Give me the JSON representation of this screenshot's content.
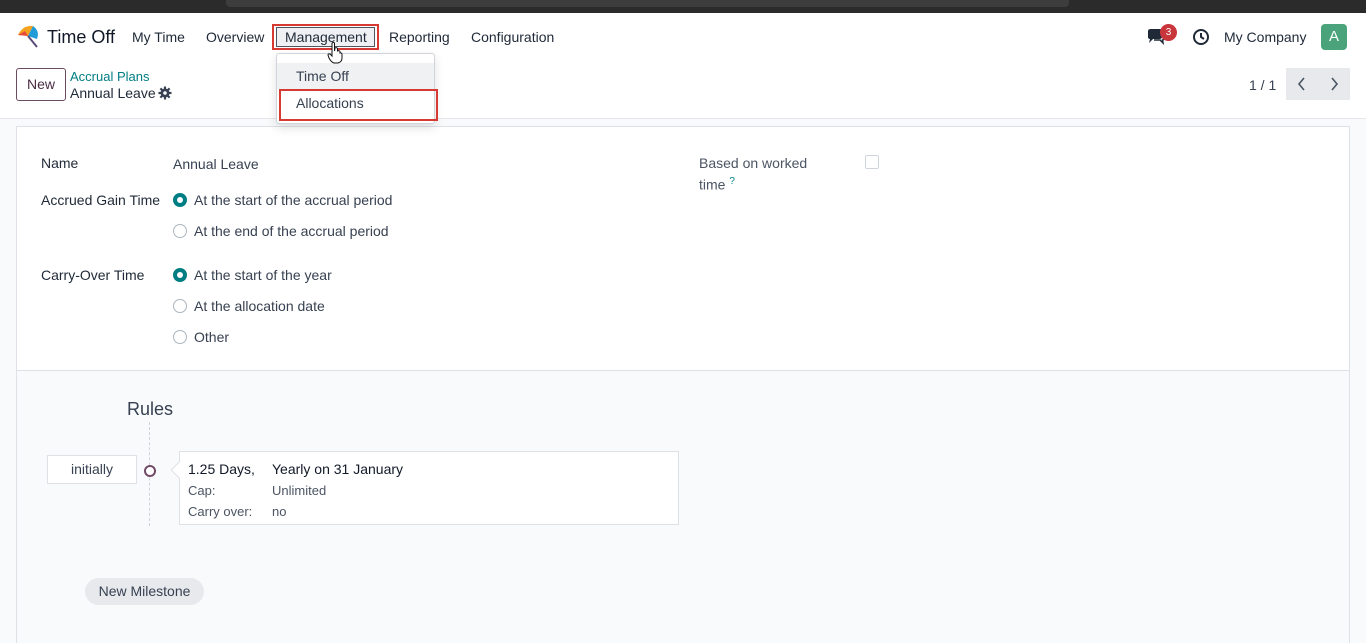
{
  "navbar": {
    "app_name": "Time Off",
    "menu": [
      "My Time",
      "Overview",
      "Management",
      "Reporting",
      "Configuration"
    ],
    "notification_count": "3",
    "company": "My Company",
    "avatar_letter": "A"
  },
  "management_dropdown": {
    "items": [
      "Time Off",
      "Allocations"
    ]
  },
  "control": {
    "new_label": "New",
    "breadcrumb_parent": "Accrual Plans",
    "breadcrumb_current": "Annual Leave",
    "pager": "1 / 1"
  },
  "form": {
    "name_label": "Name",
    "name_value": "Annual Leave",
    "accrued_label": "Accrued Gain Time",
    "accrued_options": [
      "At the start of the accrual period",
      "At the end of the accrual period"
    ],
    "accrued_selected": 0,
    "carry_label": "Carry-Over Time",
    "carry_options": [
      "At the start of the year",
      "At the allocation date",
      "Other"
    ],
    "carry_selected": 0,
    "worked_label_line1": "Based on worked",
    "worked_label_line2": "time",
    "worked_help": "?",
    "worked_checked": false
  },
  "rules": {
    "title": "Rules",
    "start_label": "initially",
    "card": {
      "amount": "1.25 Days,",
      "frequency": "Yearly on 31 January",
      "cap_label": "Cap:",
      "cap_value": "Unlimited",
      "carry_label": "Carry over:",
      "carry_value": "no"
    },
    "new_milestone": "New Milestone"
  },
  "colors": {
    "accent": "#017e84",
    "brand": "#714b67",
    "highlight_box": "#d63a32",
    "badge": "#c8363c",
    "avatar": "#4aa37a"
  }
}
